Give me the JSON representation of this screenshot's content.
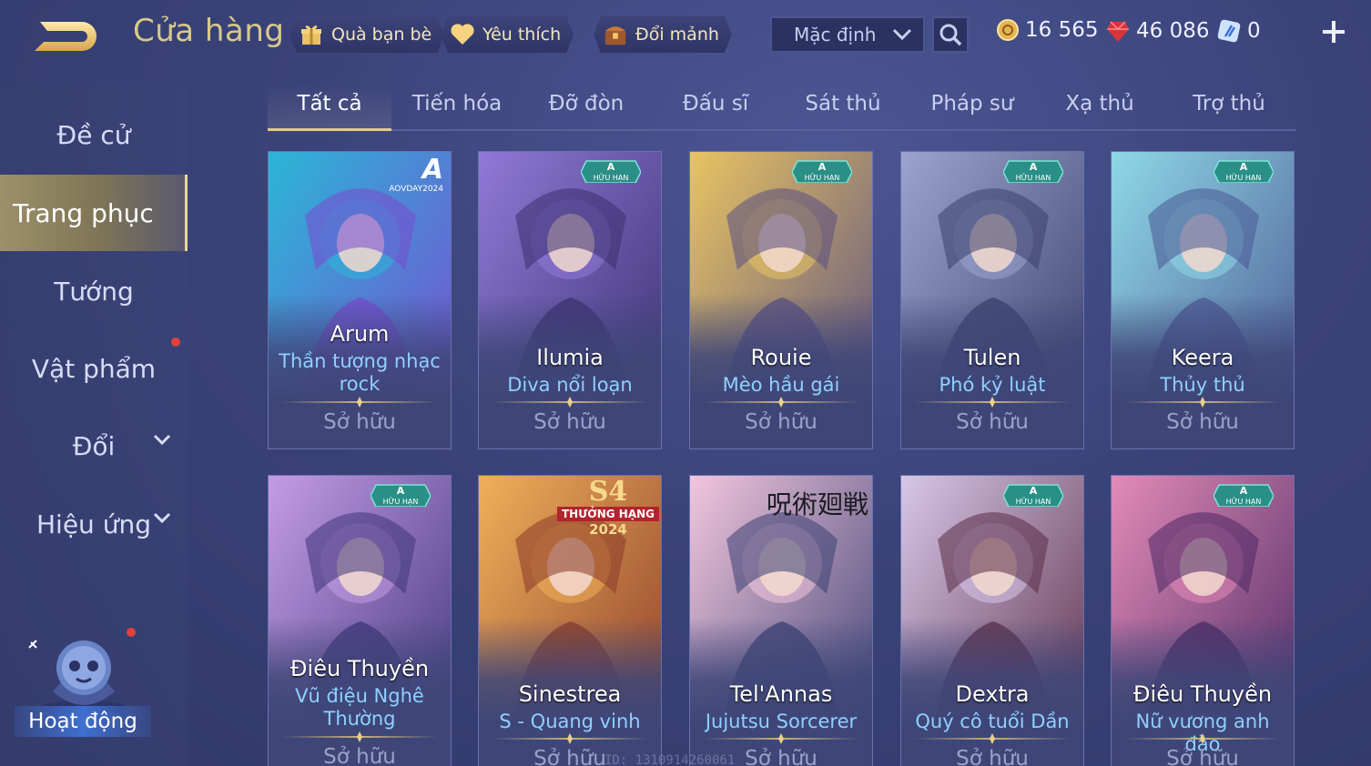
{
  "header": {
    "title": "Cửa hàng",
    "friend_gift": "Quà bạn bè",
    "favorite": "Yêu thích",
    "exchange": "Đổi mảnh",
    "sort_selected": "Mặc định",
    "currencies": [
      {
        "name": "gold-coin",
        "value": "16 565"
      },
      {
        "name": "red-gem",
        "value": "46 086"
      },
      {
        "name": "voucher",
        "value": "0"
      }
    ]
  },
  "sidebar": {
    "items": [
      {
        "label": "Đề cử"
      },
      {
        "label": "Trang phục"
      },
      {
        "label": "Tướng"
      },
      {
        "label": "Vật phẩm"
      },
      {
        "label": "Đổi"
      },
      {
        "label": "Hiệu ứng"
      }
    ],
    "activity": "Hoạt động"
  },
  "tabs": [
    "Tất cả",
    "Tiến hóa",
    "Đỡ đòn",
    "Đấu sĩ",
    "Sát thủ",
    "Pháp sư",
    "Xạ thủ",
    "Trợ thủ"
  ],
  "badges": {
    "limited": "A HỮU HẠN",
    "aov_day": "AOVDAY2024",
    "season": "S4",
    "season_sub": "THƯỞNG HẠNG",
    "season_year": "2024",
    "jjk": "呪術廻戦"
  },
  "cards": [
    {
      "hero": "Arum",
      "skin": "Thần tượng nhạc rock",
      "status": "Sở hữu",
      "colors": [
        "#2bb6d8",
        "#7a4bd0"
      ]
    },
    {
      "hero": "Ilumia",
      "skin": "Diva nổi loạn",
      "status": "Sở hữu",
      "colors": [
        "#8f7ad8",
        "#3b2f6e"
      ]
    },
    {
      "hero": "Rouie",
      "skin": "Mèo hầu gái",
      "status": "Sở hữu",
      "colors": [
        "#e8c462",
        "#5a4e82"
      ]
    },
    {
      "hero": "Tulen",
      "skin": "Phó kỷ luật",
      "status": "Sở hữu",
      "colors": [
        "#9aa4cf",
        "#3a3f6a"
      ]
    },
    {
      "hero": "Keera",
      "skin": "Thủy thủ",
      "status": "Sở hữu",
      "colors": [
        "#8fd8e6",
        "#4b5894"
      ]
    },
    {
      "hero": "Điêu Thuyền",
      "skin": "Vũ điệu Nghê Thường",
      "status": "Sở hữu",
      "colors": [
        "#c59ce6",
        "#3e3478"
      ]
    },
    {
      "hero": "Sinestrea",
      "skin": "S - Quang vinh",
      "status": "Sở hữu",
      "colors": [
        "#f0b05a",
        "#8a3a2a"
      ]
    },
    {
      "hero": "Tel'Annas",
      "skin": "Jujutsu Sorcerer",
      "status": "Sở hữu",
      "colors": [
        "#f2c6dd",
        "#3a3f72"
      ]
    },
    {
      "hero": "Dextra",
      "skin": "Quý cô tuổi Dần",
      "status": "Sở hữu",
      "colors": [
        "#d7c7e9",
        "#5a2c46"
      ]
    },
    {
      "hero": "Điêu Thuyền",
      "skin": "Nữ vương anh đào",
      "status": "Sở hữu",
      "colors": [
        "#e28bb8",
        "#4a2862"
      ]
    }
  ],
  "watermark": "ID: 1310914260061"
}
